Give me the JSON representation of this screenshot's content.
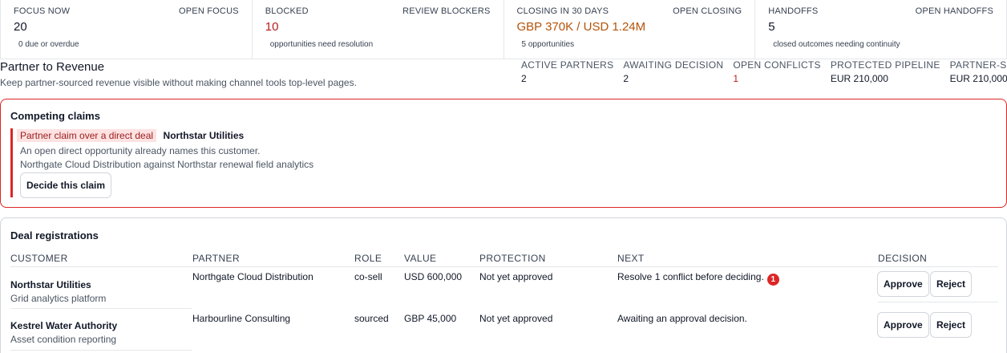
{
  "summary": [
    {
      "label": "FOCUS NOW",
      "action": "OPEN FOCUS",
      "value": "20",
      "sub": "0 due or overdue"
    },
    {
      "label": "BLOCKED",
      "action": "REVIEW BLOCKERS",
      "value": "10",
      "sub": "opportunities need resolution"
    },
    {
      "label": "CLOSING IN 30 DAYS",
      "action": "OPEN CLOSING",
      "value": "GBP 370K / USD 1.24M",
      "sub": "5 opportunities"
    },
    {
      "label": "HANDOFFS",
      "action": "OPEN HANDOFFS",
      "value": "5",
      "sub": "closed outcomes needing continuity"
    }
  ],
  "page": {
    "title": "Partner to Revenue",
    "subtitle": "Keep partner-sourced revenue visible without making channel tools top-level pages."
  },
  "metrics": [
    {
      "label": "ACTIVE PARTNERS",
      "value": "2"
    },
    {
      "label": "AWAITING DECISION",
      "value": "2"
    },
    {
      "label": "OPEN CONFLICTS",
      "value": "1"
    },
    {
      "label": "PROTECTED PIPELINE",
      "value": "EUR 210,000"
    },
    {
      "label": "PARTNER-SOURCED",
      "value": "EUR 210,000"
    }
  ],
  "claims": {
    "title": "Competing claims",
    "items": [
      {
        "tag": "Partner claim over a direct deal",
        "customer": "Northstar Utilities",
        "line1": "An open direct opportunity already names this customer.",
        "line2": "Northgate Cloud Distribution against Northstar renewal field analytics",
        "button": "Decide this claim"
      }
    ]
  },
  "deals": {
    "title": "Deal registrations",
    "columns": [
      "CUSTOMER",
      "PARTNER",
      "ROLE",
      "VALUE",
      "PROTECTION",
      "NEXT",
      "DECISION"
    ],
    "rows": [
      {
        "customer": "Northstar Utilities",
        "description": "Grid analytics platform",
        "partner": "Northgate Cloud Distribution",
        "role": "co-sell",
        "value": "USD 600,000",
        "protection": "Not yet approved",
        "next": "Resolve 1 conflict before deciding.",
        "badge": "1",
        "approve": "Approve",
        "reject": "Reject"
      },
      {
        "customer": "Kestrel Water Authority",
        "description": "Asset condition reporting",
        "partner": "Harbourline Consulting",
        "role": "sourced",
        "value": "GBP 45,000",
        "protection": "Not yet approved",
        "next": "Awaiting an approval decision.",
        "approve": "Approve",
        "reject": "Reject"
      }
    ]
  },
  "colors": {
    "danger": "#dc2626",
    "danger_text": "#b91c1c",
    "warning_text": "#b45309",
    "tag_bg": "#fee2e2"
  }
}
